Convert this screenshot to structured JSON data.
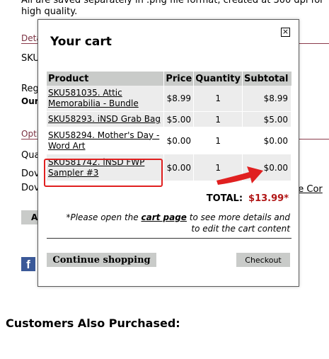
{
  "background": {
    "intro_text": "All are saved separately in .png file format, created at 300 dpi for high quality.",
    "details_label": "Deta",
    "sku_label": "SKU",
    "reg_label": "Reg",
    "our_label": "Our",
    "options_label": "Opti",
    "qty_label": "Qua",
    "dow1_label": "Dov",
    "dow2_label": "Dov",
    "link_fragment": "ge Cor",
    "button_fragment": "A",
    "fb_icon": "f",
    "section_title": "Customers Also Purchased:"
  },
  "cart": {
    "title": "Your cart",
    "close_icon": "x-icon",
    "columns": [
      "Product",
      "Price",
      "Quantity",
      "Subtotal"
    ],
    "items": [
      {
        "product": "SKU581035. Attic Memorabilia - Bundle",
        "price": "$8.99",
        "qty": "1",
        "subtotal": "$8.99"
      },
      {
        "product": "SKU58293. iNSD Grab Bag",
        "price": "$5.00",
        "qty": "1",
        "subtotal": "$5.00"
      },
      {
        "product": "SKU58294. Mother's Day - Word Art",
        "price": "$0.00",
        "qty": "1",
        "subtotal": "$0.00"
      },
      {
        "product": "SKU581742. iNSD FWP Sampler #3",
        "price": "$0.00",
        "qty": "1",
        "subtotal": "$0.00"
      }
    ],
    "total_label": "TOTAL:",
    "total_value": "$13.99*",
    "note_prefix": "*Please open the ",
    "note_link": "cart page",
    "note_suffix": " to see more details and to edit the cart content",
    "continue_label": "Continue shopping",
    "checkout_label": "Checkout",
    "annotation_color": "#e02020",
    "total_color": "#b11616"
  }
}
